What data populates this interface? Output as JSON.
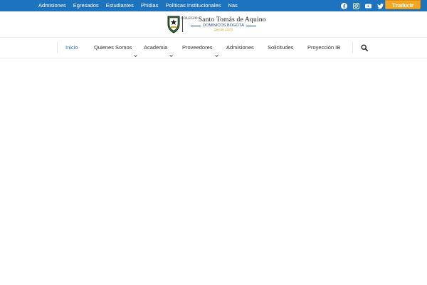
{
  "topbar": {
    "links": [
      "Admisiones",
      "Egresados",
      "Estudiantes",
      "Phidias",
      "Políticas Institucionales",
      "Nas"
    ],
    "translate_label": "Traducir",
    "social_icons": [
      "facebook-icon",
      "instagram-icon",
      "youtube-icon",
      "twitter-icon",
      "linkedin-icon"
    ],
    "bar_color": "#1e73be",
    "translate_color": "#f5a623"
  },
  "logo": {
    "small": "COLEGIO",
    "name": "Santo Tomás de Aquino",
    "sub": "DOMINICOS BOGOTÁ",
    "since": "Desde 1573"
  },
  "nav": {
    "items": [
      "Inicio",
      "Quienes Somos",
      "Academia",
      "Proveedores",
      "Admisiones",
      "Solicitudes",
      "Proyección IB"
    ],
    "active_color": "#1e73be"
  }
}
